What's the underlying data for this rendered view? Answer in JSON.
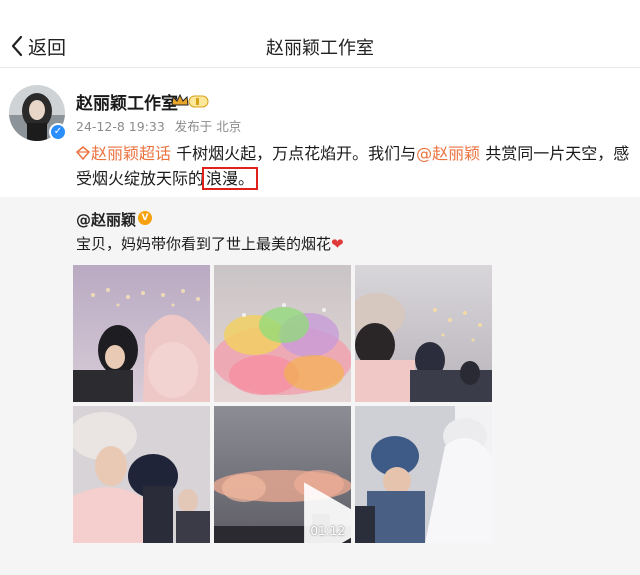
{
  "nav": {
    "back_label": "返回",
    "title": "赵丽颖工作室"
  },
  "post": {
    "author": "赵丽颖工作室",
    "date": "24-12-8 19:33",
    "source": "发布于 北京",
    "content": {
      "topic": "赵丽颖超话",
      "text_a": " 千树烟火起，万点花焰开。我们与",
      "mention": "@赵丽颖",
      "text_b": " 共赏同一片天空，感受烟火绽放天际的",
      "highlighted": "浪漫。"
    }
  },
  "repost": {
    "author": "@赵丽颖",
    "text": "宝贝，妈妈带你看到了世上最美的烟花",
    "heart": "❤",
    "images": [
      {
        "name": "photo-1",
        "kind": "photo"
      },
      {
        "name": "photo-2",
        "kind": "photo"
      },
      {
        "name": "photo-3",
        "kind": "photo"
      },
      {
        "name": "photo-4",
        "kind": "photo"
      },
      {
        "name": "video-5",
        "kind": "video",
        "duration": "01:12"
      },
      {
        "name": "photo-6",
        "kind": "photo"
      }
    ]
  },
  "colors": {
    "link": "#eb7340",
    "highlight_border": "#e0201b",
    "verify_blue": "#2a8ffd"
  },
  "icons": [
    "chevron-left-icon",
    "verified-icon",
    "vip-crown-icon",
    "topic-diamond-icon",
    "gold-v-icon",
    "play-icon"
  ]
}
